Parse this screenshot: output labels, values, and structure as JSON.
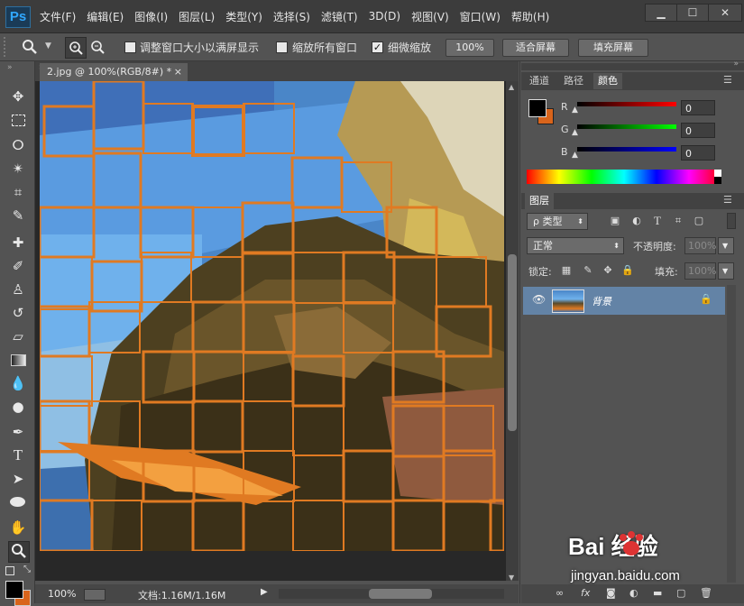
{
  "app": {
    "logo": "Ps"
  },
  "menu": [
    "文件(F)",
    "编辑(E)",
    "图像(I)",
    "图层(L)",
    "类型(Y)",
    "选择(S)",
    "滤镜(T)",
    "3D(D)",
    "视图(V)",
    "窗口(W)",
    "帮助(H)"
  ],
  "window_controls": {
    "minimize": "▁",
    "maximize": "☐",
    "close": "✕"
  },
  "options": {
    "resize_windows": "调整窗口大小以满屏显示",
    "zoom_all": "缩放所有窗口",
    "scrubby_zoom": "细微缩放",
    "btn_100": "100%",
    "btn_fit": "适合屏幕",
    "btn_fill": "填充屏幕"
  },
  "document": {
    "tab_title": "2.jpg @ 100%(RGB/8#) *",
    "close": "×"
  },
  "status": {
    "zoom": "100%",
    "doc_size": "文档:1.16M/1.16M"
  },
  "color_panel": {
    "tabs": [
      "通道",
      "路径",
      "颜色"
    ],
    "r_label": "R",
    "g_label": "G",
    "b_label": "B",
    "r_value": "0",
    "g_value": "0",
    "b_value": "0",
    "foreground": "#000000",
    "background": "#d9641b"
  },
  "layers_panel": {
    "tab": "图层",
    "filter_kind": "ρ 类型",
    "blend_mode": "正常",
    "opacity_label": "不透明度:",
    "opacity_value": "100%",
    "lock_label": "锁定:",
    "fill_label": "填充:",
    "fill_value": "100%",
    "layer_name": "背景"
  },
  "watermark": {
    "brand": "Bai  经验",
    "url": "jingyan.baidu.com"
  }
}
